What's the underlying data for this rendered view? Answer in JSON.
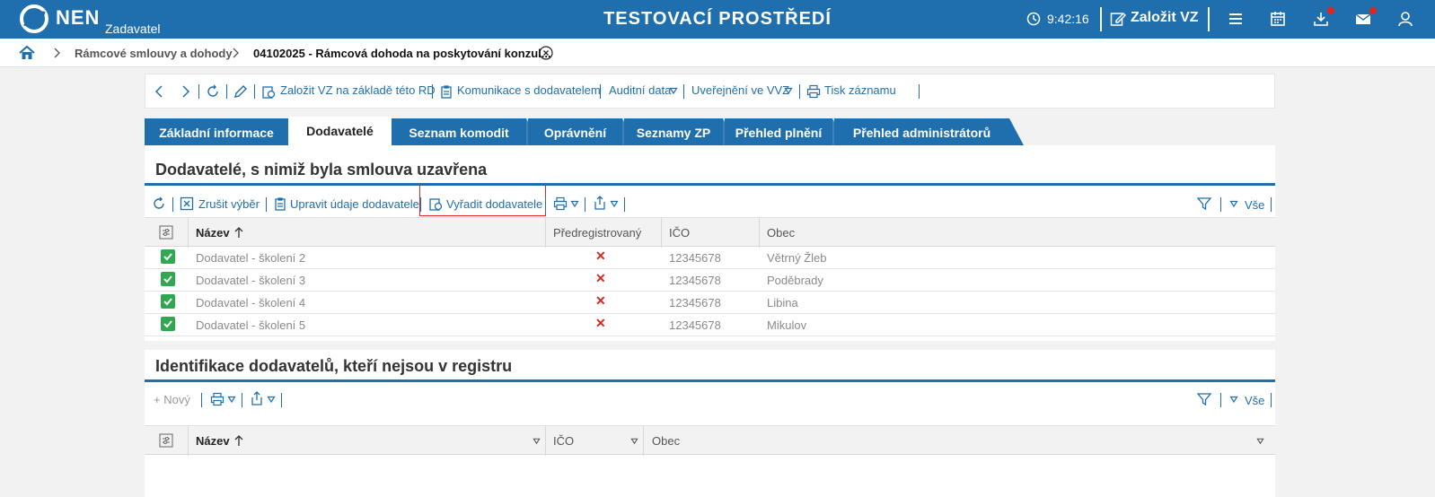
{
  "topbar": {
    "logo_text": "NEN",
    "logo_sub": "Zadavatel",
    "env_title": "TESTOVACÍ PROSTŘEDÍ",
    "clock": "9:42:16",
    "new_label": "Založit VZ"
  },
  "breadcrumb": {
    "item1": "Rámcové smlouvy a dohody",
    "item2": "04102025 - Rámcová dohoda na poskytování konzul..."
  },
  "record_toolbar": {
    "create_rd": "Založit VZ na základě této RD",
    "comm": "Komunikace s dodavatelem",
    "audit": "Auditní data",
    "publish": "Uveřejnění ve VVZ",
    "print": "Tisk záznamu"
  },
  "tabs": [
    {
      "label": "Základní informace"
    },
    {
      "label": "Dodavatelé"
    },
    {
      "label": "Seznam komodit"
    },
    {
      "label": "Oprávnění"
    },
    {
      "label": "Seznamy ZP"
    },
    {
      "label": "Přehled plnění"
    },
    {
      "label": "Přehled administrátorů"
    }
  ],
  "suppliers": {
    "title": "Dodavatelé, s nimiž byla smlouva uzavřena",
    "clear": "Zrušit výběr",
    "edit": "Upravit údaje dodavatele",
    "remove": "Vyřadit dodavatele",
    "all": "Vše",
    "columns": {
      "name": "Název",
      "prereg": "Předregistrovaný",
      "ico": "IČO",
      "city": "Obec"
    },
    "rows": [
      {
        "name": "Dodavatel - školení 2",
        "prereg": "✕",
        "ico": "12345678",
        "city": "Větrný Žleb"
      },
      {
        "name": "Dodavatel - školení 3",
        "prereg": "✕",
        "ico": "12345678",
        "city": "Poděbrady"
      },
      {
        "name": "Dodavatel - školení 4",
        "prereg": "✕",
        "ico": "12345678",
        "city": "Libina"
      },
      {
        "name": "Dodavatel - školení 5",
        "prereg": "✕",
        "ico": "12345678",
        "city": "Mikulov"
      }
    ]
  },
  "unregistered": {
    "title": "Identifikace dodavatelů, kteří nejsou v registru",
    "new": "+ Nový",
    "all": "Vše",
    "columns": {
      "name": "Název",
      "ico": "IČO",
      "city": "Obec"
    }
  },
  "colors": {
    "brand": "#1f6fae",
    "ok": "#2fa84f",
    "error": "#d52a22"
  }
}
